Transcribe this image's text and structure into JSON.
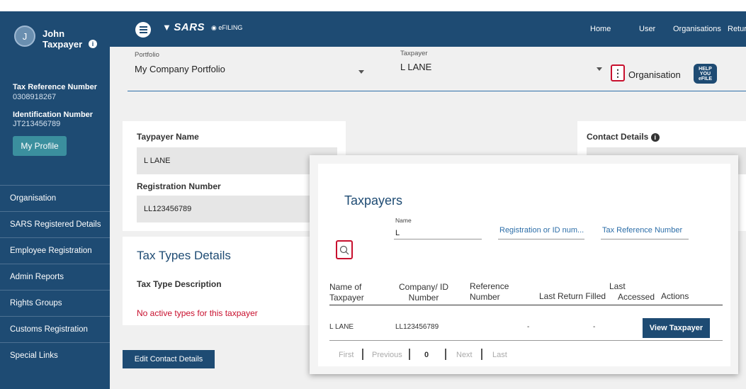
{
  "user": {
    "initial": "J",
    "first_name": "John",
    "last_name": "Taxpayer",
    "tax_ref_label": "Tax Reference Number",
    "tax_ref_value": "0308918267",
    "id_label": "Identification Number",
    "id_value": "JT213456789",
    "profile_button": "My Profile"
  },
  "sidebar": {
    "items": [
      {
        "label": "Organisation"
      },
      {
        "label": "SARS Registered Details"
      },
      {
        "label": "Employee Registration"
      },
      {
        "label": "Admin Reports"
      },
      {
        "label": "Rights Groups"
      },
      {
        "label": "Customs Registration"
      },
      {
        "label": "Special Links"
      }
    ]
  },
  "topbar": {
    "brand": "SARS",
    "brand_sub": "eFILING",
    "nav": [
      "Home",
      "User",
      "Organisations",
      "Retur"
    ]
  },
  "selectors": {
    "portfolio_label": "Portfolio",
    "portfolio_value": "My Company Portfolio",
    "taxpayer_label": "Taxpayer",
    "taxpayer_value": "L LANE",
    "organisation_label": "Organisation",
    "help_icon_text": "HELP YOU eFILE"
  },
  "details": {
    "taxpayer_name_label": "Taypayer Name",
    "taxpayer_name_value": "L LANE",
    "reg_number_label": "Registration Number",
    "reg_number_value": "LL123456789",
    "contact_label": "Contact Details",
    "tax_types_title": "Tax Types Details",
    "tax_type_desc_label": "Tax Type Description",
    "no_types_text": "No active types for this taxpayer",
    "edit_contact_button": "Edit Contact Details"
  },
  "modal": {
    "title": "Taxpayers",
    "name_field_label": "Name",
    "name_field_value": "L",
    "reg_field_placeholder": "Registration or ID num...",
    "taxref_field_placeholder": "Tax Reference Number",
    "columns": {
      "name_1": "Name of",
      "name_2": "Taxpayer",
      "company_1": "Company/ ID",
      "company_2": "Number",
      "ref_1": "Reference",
      "ref_2": "Number",
      "last_return": "Last Return Filled",
      "accessed_1": "Last",
      "accessed_2": "Accessed",
      "actions": "Actions"
    },
    "row": {
      "name": "L LANE",
      "company_id": "LL123456789",
      "reference": "",
      "last_return": "-",
      "last_accessed": "-",
      "action": "View Taxpayer"
    },
    "pager": {
      "first": "First",
      "previous": "Previous",
      "page": "0",
      "next": "Next",
      "last": "Last"
    }
  },
  "colors": {
    "primary": "#1e4b73",
    "highlight": "#c8102e",
    "profile_button": "#3b8f9e"
  }
}
